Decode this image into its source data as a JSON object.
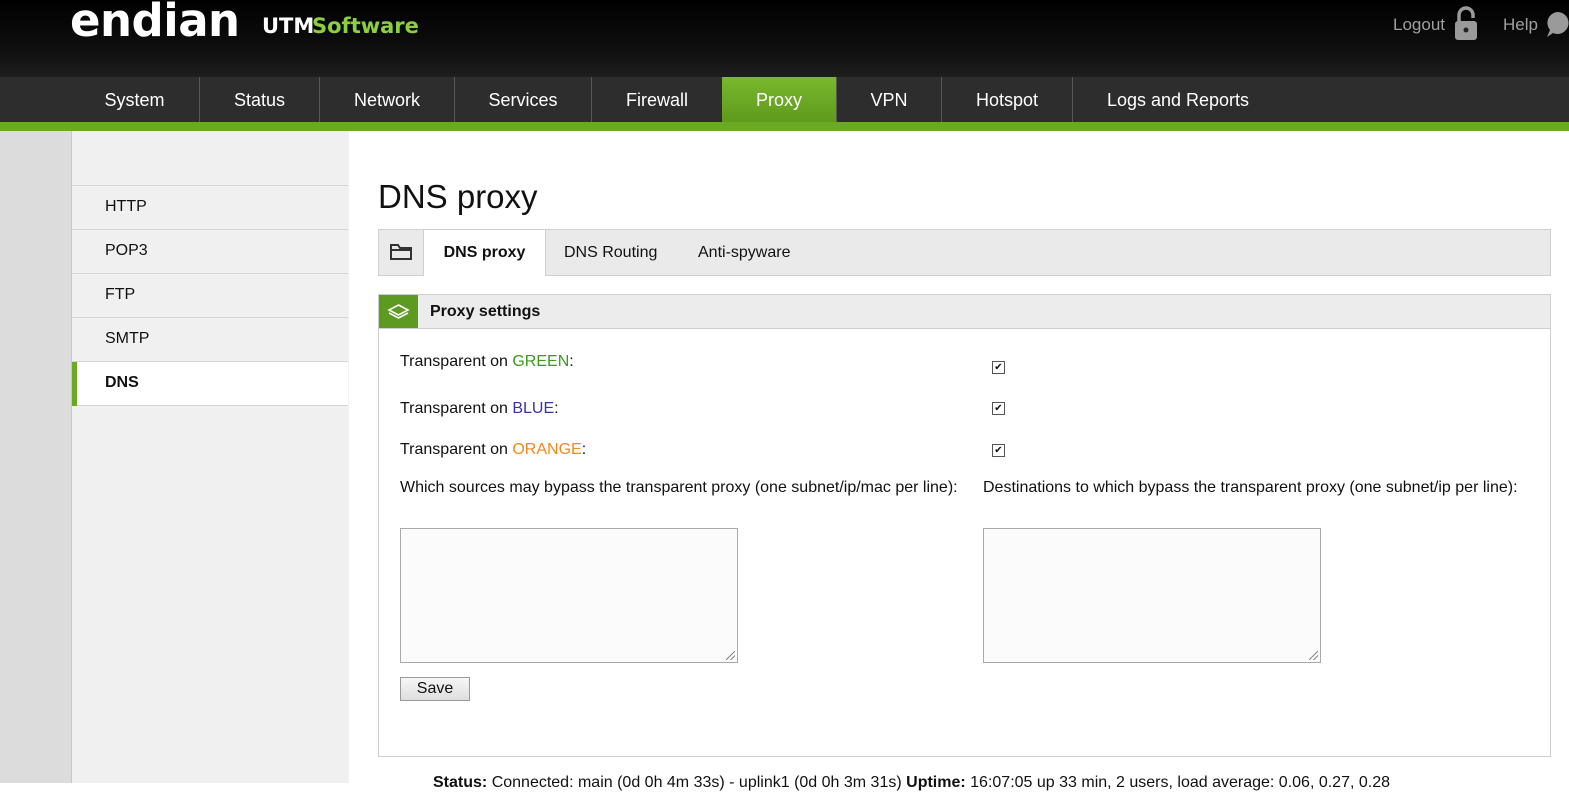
{
  "header": {
    "logo_main": "endian",
    "logo_utm": "UTM",
    "logo_software": "Software",
    "logout_label": "Logout",
    "help_label": "Help"
  },
  "nav": {
    "items": [
      {
        "label": "System"
      },
      {
        "label": "Status"
      },
      {
        "label": "Network"
      },
      {
        "label": "Services"
      },
      {
        "label": "Firewall"
      },
      {
        "label": "Proxy",
        "active": true
      },
      {
        "label": "VPN"
      },
      {
        "label": "Hotspot"
      },
      {
        "label": "Logs and Reports"
      }
    ]
  },
  "sidebar": {
    "items": [
      {
        "label": "HTTP"
      },
      {
        "label": "POP3"
      },
      {
        "label": "FTP"
      },
      {
        "label": "SMTP"
      },
      {
        "label": "DNS",
        "active": true
      }
    ]
  },
  "page": {
    "title": "DNS proxy"
  },
  "tabs": {
    "items": [
      {
        "label": "DNS proxy",
        "active": true
      },
      {
        "label": "DNS Routing"
      },
      {
        "label": "Anti-spyware"
      }
    ]
  },
  "panel": {
    "title": "Proxy settings",
    "transparent_prefix": "Transparent on ",
    "colon": ":",
    "rows": [
      {
        "zone": "GREEN",
        "zone_color": "#3b9a1e",
        "checked": true
      },
      {
        "zone": "BLUE",
        "zone_color": "#3a32a8",
        "checked": true
      },
      {
        "zone": "ORANGE",
        "zone_color": "#f28a1a",
        "checked": true
      }
    ],
    "sources_label": "Which sources may bypass the transparent proxy (one subnet/ip/mac per line):",
    "sources_value": "",
    "destinations_label": "Destinations to which bypass the transparent proxy (one subnet/ip per line):",
    "destinations_value": "",
    "save_label": "Save"
  },
  "status": {
    "status_key": "Status:",
    "status_value": "Connected: main (0d 0h 4m 33s) - uplink1 (0d 0h 3m 31s)",
    "uptime_key": "Uptime:",
    "uptime_value": "16:07:05 up 33 min, 2 users, load average: 0.06, 0.27, 0.28"
  },
  "icons": {
    "logout": "lock-icon",
    "help": "help-bubble-icon",
    "tab_folder": "folder-icon",
    "panel": "layers-icon"
  }
}
